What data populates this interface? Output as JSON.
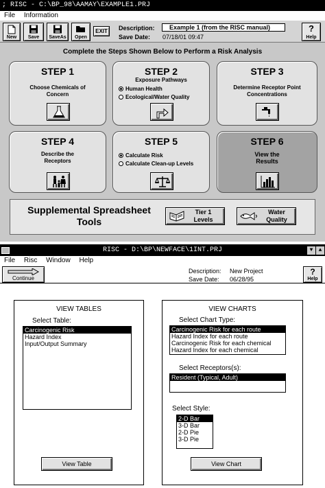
{
  "win1": {
    "title": "; RISC - C:\\BP_98\\AAMAY\\EXAMPLE1.PRJ",
    "menu": [
      "File",
      "Information"
    ],
    "toolbar": [
      "New",
      "Save",
      "SaveAs",
      "Open",
      "EXIT"
    ],
    "description_label": "Description:",
    "description_value": "Example 1 (from the RISC manual)",
    "save_date_label": "Save Date:",
    "save_date_value": "07/18/01  09:47",
    "help_label": "Help",
    "instructions": "Complete the Steps Shown Below to Perform a Risk Analysis",
    "steps": [
      {
        "title": "STEP 1",
        "desc": "Choose Chemicals of Concern",
        "icon": "flask-icon"
      },
      {
        "title": "STEP 2",
        "desc": "Exposure Pathways",
        "options": [
          "Human Health",
          "Ecological/Water Quality"
        ],
        "selected": 0,
        "icon": "arrow-turn-icon"
      },
      {
        "title": "STEP 3",
        "desc": "Determine Receptor Point Concentrations",
        "icon": "faucet-icon"
      },
      {
        "title": "STEP 4",
        "desc": "Describe the Receptors",
        "icon": "family-icon"
      },
      {
        "title": "STEP 5",
        "options": [
          "Calculate Risk",
          "Calculate Clean-up Levels"
        ],
        "selected": 0,
        "icon": "scales-icon"
      },
      {
        "title": "STEP 6",
        "desc": "View the Results",
        "icon": "bar-chart-icon"
      }
    ],
    "supplemental": {
      "title": "Supplemental Spreadsheet Tools",
      "tier1_label": "Tier 1 Levels",
      "water_label": "Water Quality"
    }
  },
  "win2": {
    "title": "RISC - D:\\BP\\NEWFACE\\1INT.PRJ",
    "menu": [
      "File",
      "Risc",
      "Window",
      "Help"
    ],
    "continue_label": "Continue",
    "description_label": "Description:",
    "description_value": "New Project",
    "save_date_label": "Save Date:",
    "save_date_value": "06/28/95",
    "help_label": "Help",
    "view_tables": {
      "title": "VIEW TABLES",
      "select_label": "Select Table:",
      "items": [
        "Carcinogenic Risk",
        "Hazard Index",
        "Input/Output Summary"
      ],
      "selected": 0,
      "button": "View Table"
    },
    "view_charts": {
      "title": "VIEW CHARTS",
      "chart_type_label": "Select Chart Type:",
      "chart_types": [
        "Carcinogenic Risk for each route",
        "Hazard Index for each route",
        "Carcinogenic Risk for each chemical",
        "Hazard Index for each chemical"
      ],
      "chart_selected": 0,
      "receptors_label": "Select Receptors(s):",
      "receptors": [
        "Resident (Typical, Adult)"
      ],
      "receptor_selected": 0,
      "style_label": "Select Style:",
      "styles": [
        "2-D Bar",
        "3-D Bar",
        "2-D Pie",
        "3-D Pie"
      ],
      "style_selected": 0,
      "button": "View Chart"
    }
  }
}
